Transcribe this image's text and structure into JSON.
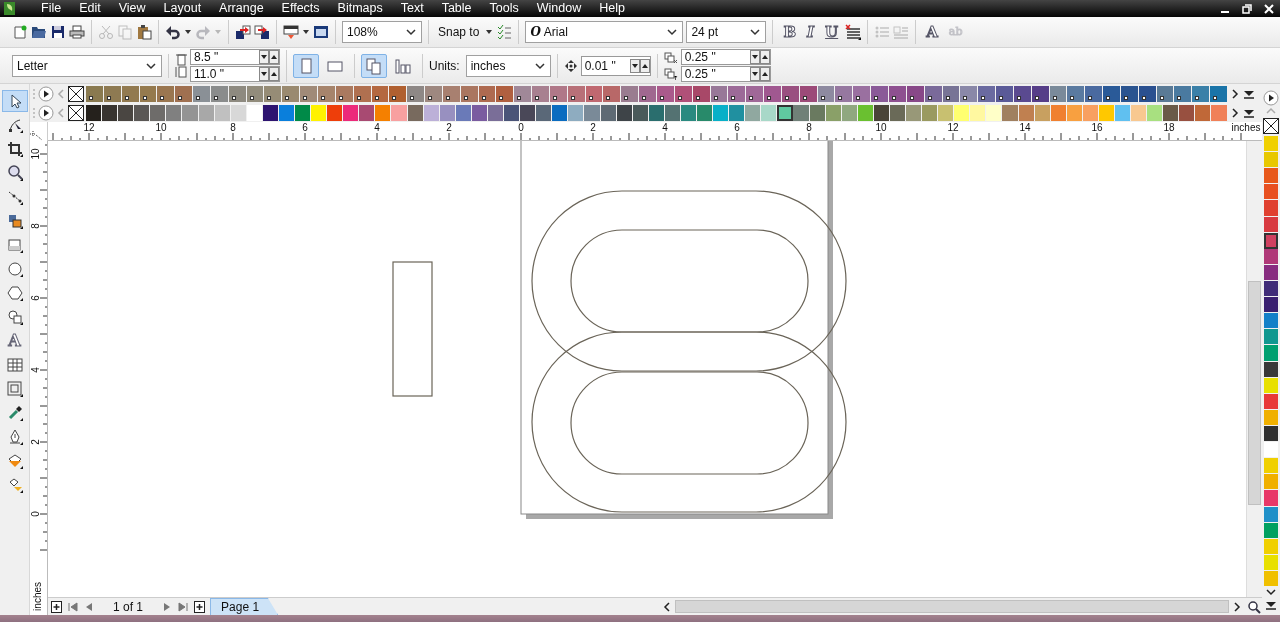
{
  "menu": {
    "items": [
      "File",
      "Edit",
      "View",
      "Layout",
      "Arrange",
      "Effects",
      "Bitmaps",
      "Text",
      "Table",
      "Tools",
      "Window",
      "Help"
    ]
  },
  "standard_toolbar": {
    "groups": [
      [
        {
          "kind": "new",
          "disabled": false
        },
        {
          "kind": "open",
          "disabled": false
        },
        {
          "kind": "save",
          "disabled": false
        },
        {
          "kind": "print",
          "disabled": false
        }
      ],
      [
        {
          "kind": "cut",
          "disabled": true
        },
        {
          "kind": "copy",
          "disabled": true
        },
        {
          "kind": "paste",
          "disabled": false
        }
      ],
      [
        {
          "kind": "undo",
          "disabled": false
        },
        {
          "kind": "caret",
          "disabled": false
        },
        {
          "kind": "redo",
          "disabled": true
        },
        {
          "kind": "caret",
          "disabled": true
        }
      ],
      [
        {
          "kind": "import",
          "disabled": false
        },
        {
          "kind": "export",
          "disabled": false
        }
      ],
      [
        {
          "kind": "launcher",
          "disabled": false
        },
        {
          "kind": "caret",
          "disabled": false
        },
        {
          "kind": "welcome",
          "disabled": false
        }
      ],
      [
        {
          "kind": "zoom-combo",
          "value": "108%",
          "disabled": false
        }
      ],
      [
        {
          "kind": "snap",
          "label": "Snap to",
          "disabled": false
        },
        {
          "kind": "caret",
          "disabled": false
        },
        {
          "kind": "snapopts",
          "disabled": false
        }
      ],
      [
        {
          "kind": "font-combo",
          "glyph": "O",
          "value": "Arial",
          "disabled": false
        },
        {
          "kind": "size-combo",
          "value": "24 pt",
          "disabled": false
        }
      ],
      [
        {
          "kind": "bold",
          "glyph": "B",
          "disabled": false
        },
        {
          "kind": "italic",
          "glyph": "I",
          "disabled": false
        },
        {
          "kind": "underline",
          "glyph": "U",
          "disabled": false
        },
        {
          "kind": "align",
          "disabled": false
        }
      ],
      [
        {
          "kind": "bullets",
          "disabled": true
        },
        {
          "kind": "dropcap",
          "disabled": true
        }
      ],
      [
        {
          "kind": "edittext",
          "glyph": "A",
          "disabled": false
        },
        {
          "kind": "textframe",
          "glyph": "ab",
          "disabled": true
        }
      ]
    ]
  },
  "property_bar": {
    "paper_size": "Letter",
    "page_width": "8.5 \"",
    "page_height": "11.0 \"",
    "orientation": [
      {
        "kind": "portrait",
        "selected": true
      },
      {
        "kind": "landscape",
        "selected": false
      }
    ],
    "page_layout": [
      {
        "kind": "all-pages",
        "selected": true
      },
      {
        "kind": "current-page",
        "selected": false
      }
    ],
    "units_label": "Units:",
    "units": "inches",
    "nudge": "0.01 \"",
    "duplicate_x": "0.25 \"",
    "duplicate_y": "0.25 \""
  },
  "palette_rows": [
    {
      "swatches": [
        {
          "color": "#8a7a50",
          "selected": false
        },
        {
          "color": "#8e7a52",
          "selected": false
        },
        {
          "color": "#927a50",
          "selected": false
        },
        {
          "color": "#957a4e",
          "selected": false
        },
        {
          "color": "#9a7650",
          "selected": false
        },
        {
          "color": "#a07050",
          "selected": false
        },
        {
          "color": "#8a9096",
          "selected": false
        },
        {
          "color": "#8a8c8c",
          "selected": false
        },
        {
          "color": "#8e8a80",
          "selected": false
        },
        {
          "color": "#928c7c",
          "selected": false
        },
        {
          "color": "#968c76",
          "selected": false
        },
        {
          "color": "#9a8a70",
          "selected": false
        },
        {
          "color": "#a08a78",
          "selected": false
        },
        {
          "color": "#a6846c",
          "selected": false
        },
        {
          "color": "#aa7a60",
          "selected": false
        },
        {
          "color": "#b07050",
          "selected": false
        },
        {
          "color": "#b46840",
          "selected": false
        },
        {
          "color": "#b06030",
          "selected": false
        },
        {
          "color": "#8e8886",
          "selected": false
        },
        {
          "color": "#9e8880",
          "selected": false
        },
        {
          "color": "#a88070",
          "selected": false
        },
        {
          "color": "#aa7660",
          "selected": false
        },
        {
          "color": "#ae6a50",
          "selected": false
        },
        {
          "color": "#b06040",
          "selected": false
        },
        {
          "color": "#a08898",
          "selected": false
        },
        {
          "color": "#a88090",
          "selected": false
        },
        {
          "color": "#b07888",
          "selected": false
        },
        {
          "color": "#b87078",
          "selected": false
        },
        {
          "color": "#c06870",
          "selected": false
        },
        {
          "color": "#b86868",
          "selected": false
        },
        {
          "color": "#9a7c90",
          "selected": false
        },
        {
          "color": "#a06890",
          "selected": false
        },
        {
          "color": "#aa5a8c",
          "selected": false
        },
        {
          "color": "#b05078",
          "selected": false
        },
        {
          "color": "#a84868",
          "selected": false
        },
        {
          "color": "#987898",
          "selected": false
        },
        {
          "color": "#9c6a98",
          "selected": false
        },
        {
          "color": "#a06898",
          "selected": false
        },
        {
          "color": "#a05890",
          "selected": false
        },
        {
          "color": "#9a5080",
          "selected": false
        },
        {
          "color": "#9c4a78",
          "selected": false
        },
        {
          "color": "#8e8aa0",
          "selected": false
        },
        {
          "color": "#9678a0",
          "selected": false
        },
        {
          "color": "#9a70a0",
          "selected": false
        },
        {
          "color": "#8a5a98",
          "selected": false
        },
        {
          "color": "#8e5090",
          "selected": false
        },
        {
          "color": "#884888",
          "selected": false
        },
        {
          "color": "#7a6a9a",
          "selected": false
        },
        {
          "color": "#787496",
          "selected": false
        },
        {
          "color": "#8a88a8",
          "selected": false
        },
        {
          "color": "#6a6aa0",
          "selected": false
        },
        {
          "color": "#5a5a98",
          "selected": false
        },
        {
          "color": "#5a4a90",
          "selected": false
        },
        {
          "color": "#563e88",
          "selected": false
        },
        {
          "color": "#7a8a9a",
          "selected": false
        },
        {
          "color": "#5a7aa0",
          "selected": false
        },
        {
          "color": "#4a6aa0",
          "selected": false
        },
        {
          "color": "#2a5a98",
          "selected": false
        },
        {
          "color": "#2a5490",
          "selected": false
        },
        {
          "color": "#2a5090",
          "selected": false
        },
        {
          "color": "#5a7a96",
          "selected": false
        },
        {
          "color": "#4a7aa0",
          "selected": false
        },
        {
          "color": "#3a80a8",
          "selected": false
        },
        {
          "color": "#1a74a8",
          "selected": false
        }
      ]
    },
    {
      "swatches": [
        {
          "color": "#25211c",
          "selected": false
        },
        {
          "color": "#383430",
          "selected": false
        },
        {
          "color": "#4a4642",
          "selected": false
        },
        {
          "color": "#5a5755",
          "selected": false
        },
        {
          "color": "#6e6c6a",
          "selected": false
        },
        {
          "color": "#808080",
          "selected": false
        },
        {
          "color": "#949494",
          "selected": false
        },
        {
          "color": "#a8a8a8",
          "selected": false
        },
        {
          "color": "#c0c0c0",
          "selected": false
        },
        {
          "color": "#d8d8d8",
          "selected": false
        },
        {
          "color": "#ffffff",
          "selected": false
        },
        {
          "color": "#2e1470",
          "selected": false
        },
        {
          "color": "#0a7fdc",
          "selected": false
        },
        {
          "color": "#008a48",
          "selected": false
        },
        {
          "color": "#fff200",
          "selected": false
        },
        {
          "color": "#ee3e0a",
          "selected": false
        },
        {
          "color": "#ec2a7a",
          "selected": false
        },
        {
          "color": "#a84a72",
          "selected": false
        },
        {
          "color": "#f58000",
          "selected": false
        },
        {
          "color": "#f8a0a0",
          "selected": false
        },
        {
          "color": "#786a5e",
          "selected": false
        },
        {
          "color": "#bcb0d8",
          "selected": false
        },
        {
          "color": "#9890c0",
          "selected": false
        },
        {
          "color": "#6a7ab8",
          "selected": false
        },
        {
          "color": "#7a5ca0",
          "selected": false
        },
        {
          "color": "#7a6e98",
          "selected": false
        },
        {
          "color": "#4a5478",
          "selected": false
        },
        {
          "color": "#4a4858",
          "selected": false
        },
        {
          "color": "#5a6878",
          "selected": false
        },
        {
          "color": "#0a6cc0",
          "selected": false
        },
        {
          "color": "#8eacc0",
          "selected": false
        },
        {
          "color": "#7a8a98",
          "selected": false
        },
        {
          "color": "#5e6a74",
          "selected": false
        },
        {
          "color": "#3e4448",
          "selected": false
        },
        {
          "color": "#4a5a5a",
          "selected": false
        },
        {
          "color": "#2a6e6e",
          "selected": false
        },
        {
          "color": "#547272",
          "selected": false
        },
        {
          "color": "#2a8a80",
          "selected": false
        },
        {
          "color": "#288a6a",
          "selected": false
        },
        {
          "color": "#08b0c8",
          "selected": false
        },
        {
          "color": "#2090a0",
          "selected": false
        },
        {
          "color": "#90a8a0",
          "selected": false
        },
        {
          "color": "#a8d8c8",
          "selected": false
        },
        {
          "color": "#60c8a0",
          "selected": true
        },
        {
          "color": "#708078",
          "selected": false
        },
        {
          "color": "#6a7a60",
          "selected": false
        },
        {
          "color": "#8aa068",
          "selected": false
        },
        {
          "color": "#90a880",
          "selected": false
        },
        {
          "color": "#6ac030",
          "selected": false
        },
        {
          "color": "#4a4438",
          "selected": false
        },
        {
          "color": "#6a6a58",
          "selected": false
        },
        {
          "color": "#989878",
          "selected": false
        },
        {
          "color": "#9a9a60",
          "selected": false
        },
        {
          "color": "#c8c070",
          "selected": false
        },
        {
          "color": "#ffff70",
          "selected": false
        },
        {
          "color": "#fff8a0",
          "selected": false
        },
        {
          "color": "#ffffc8",
          "selected": false
        },
        {
          "color": "#a08060",
          "selected": false
        },
        {
          "color": "#c08050",
          "selected": false
        },
        {
          "color": "#c8a060",
          "selected": false
        },
        {
          "color": "#f08030",
          "selected": false
        },
        {
          "color": "#f8a040",
          "selected": false
        },
        {
          "color": "#f8a060",
          "selected": false
        },
        {
          "color": "#ffc800",
          "selected": false
        },
        {
          "color": "#60c0f0",
          "selected": false
        },
        {
          "color": "#f8c890",
          "selected": false
        },
        {
          "color": "#a8e080",
          "selected": false
        },
        {
          "color": "#6a5a48",
          "selected": false
        },
        {
          "color": "#985040",
          "selected": false
        },
        {
          "color": "#c06838",
          "selected": false
        },
        {
          "color": "#f08058",
          "selected": false
        }
      ]
    }
  ],
  "docked_palette": {
    "swatches": [
      {
        "color": "#f0d000",
        "selected": false
      },
      {
        "color": "#e8c800",
        "selected": false
      },
      {
        "color": "#e8581a",
        "selected": false
      },
      {
        "color": "#e85020",
        "selected": false
      },
      {
        "color": "#e04030",
        "selected": false
      },
      {
        "color": "#d83a40",
        "selected": false
      },
      {
        "color": "#d04060",
        "selected": true
      },
      {
        "color": "#b03878",
        "selected": false
      },
      {
        "color": "#882c80",
        "selected": false
      },
      {
        "color": "#402c78",
        "selected": false
      },
      {
        "color": "#3a2070",
        "selected": false
      },
      {
        "color": "#1480c8",
        "selected": false
      },
      {
        "color": "#109890",
        "selected": false
      },
      {
        "color": "#00a070",
        "selected": false
      },
      {
        "color": "#383838",
        "selected": false
      },
      {
        "color": "#e8e000",
        "selected": false
      },
      {
        "color": "#e83838",
        "selected": false
      },
      {
        "color": "#f0b000",
        "selected": false
      },
      {
        "color": "#303030",
        "selected": false
      },
      {
        "color": "#ffffff",
        "selected": false
      },
      {
        "color": "#f0d000",
        "selected": false
      },
      {
        "color": "#f0b000",
        "selected": false
      },
      {
        "color": "#e83868",
        "selected": false
      },
      {
        "color": "#2090c8",
        "selected": false
      },
      {
        "color": "#00a060",
        "selected": false
      },
      {
        "color": "#f0d000",
        "selected": false
      },
      {
        "color": "#e8e000",
        "selected": false
      },
      {
        "color": "#f0c000",
        "selected": false
      }
    ]
  },
  "tools": [
    {
      "kind": "pointer",
      "selected": true
    },
    {
      "kind": "shape",
      "selected": false
    },
    {
      "kind": "crop",
      "selected": false
    },
    {
      "kind": "zoom",
      "selected": false
    },
    {
      "kind": "curve",
      "selected": false
    },
    {
      "kind": "smartfill",
      "selected": false
    },
    {
      "kind": "rectangle",
      "selected": false
    },
    {
      "kind": "ellipse",
      "selected": false
    },
    {
      "kind": "polygon",
      "selected": false
    },
    {
      "kind": "shapes",
      "selected": false
    },
    {
      "kind": "text",
      "glyph": "A",
      "selected": false
    },
    {
      "kind": "table",
      "selected": false
    },
    {
      "kind": "contour",
      "selected": false
    },
    {
      "kind": "eyedropper",
      "selected": false
    },
    {
      "kind": "pen",
      "selected": false
    },
    {
      "kind": "fill",
      "selected": false
    },
    {
      "kind": "interactivefill",
      "selected": false
    }
  ],
  "horizontal_ruler": {
    "labels": [
      "12",
      "10",
      "8",
      "6",
      "4",
      "2",
      "0",
      "2",
      "4",
      "6",
      "8",
      "10",
      "12",
      "14",
      "16",
      "18"
    ],
    "unit": "inches"
  },
  "vertical_ruler": {
    "labels": [
      "10",
      "8",
      "6",
      "4",
      "2",
      "0"
    ],
    "unit": "inches"
  },
  "page_navigator": {
    "page_count": "1 of 1",
    "tabs": [
      {
        "label": "Page 1",
        "selected": true
      }
    ]
  }
}
